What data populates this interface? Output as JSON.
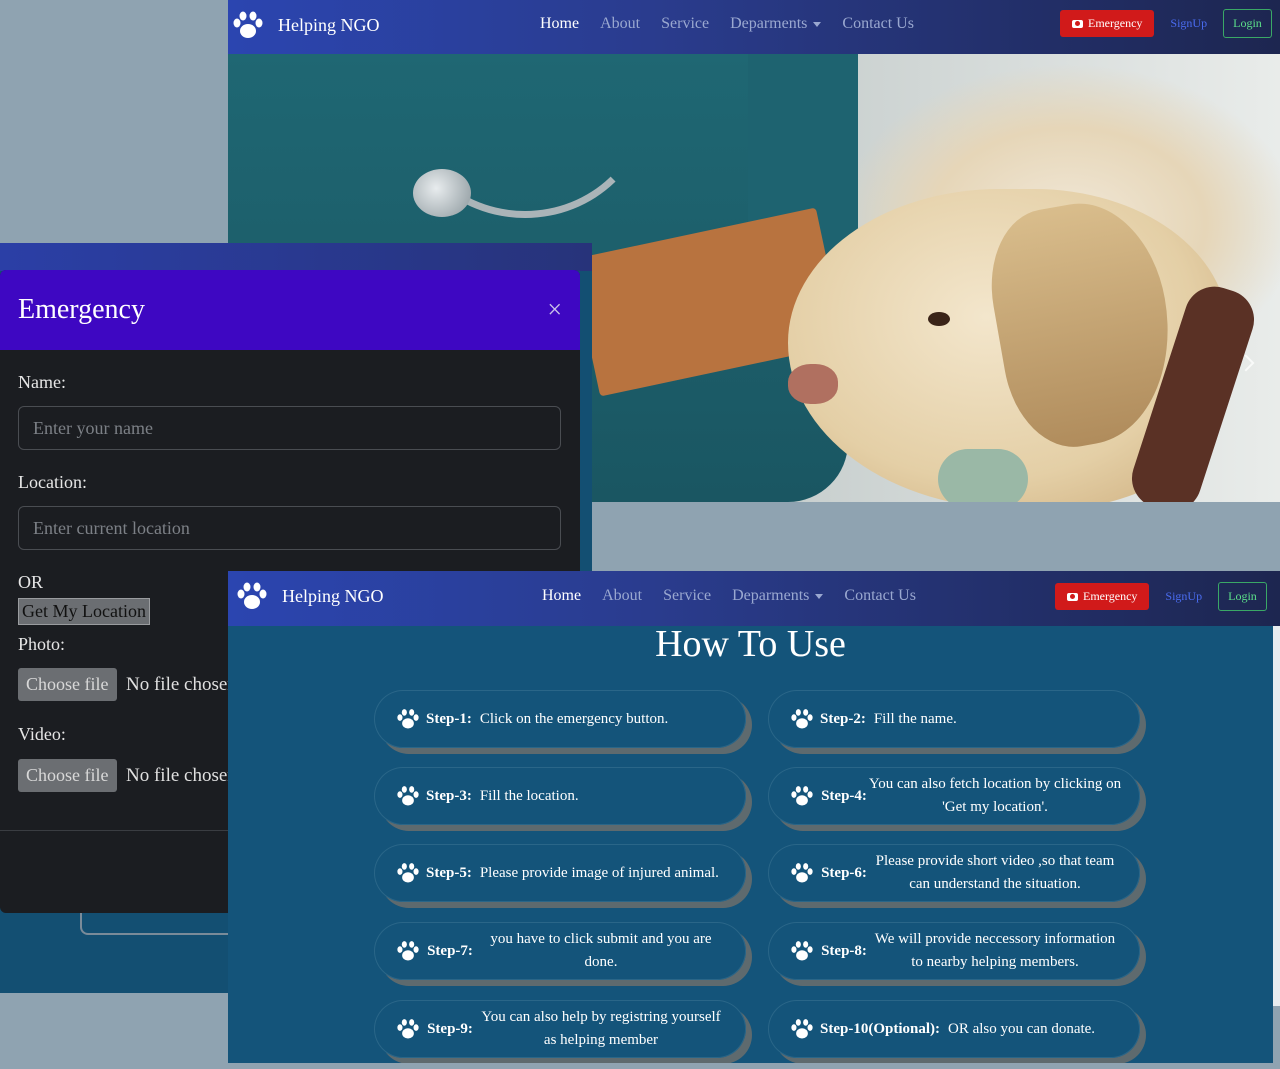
{
  "navbar": {
    "brand": "Helping NGO",
    "links": [
      "Home",
      "About",
      "Service",
      "Deparments",
      "Contact Us"
    ],
    "emergency": "Emergency",
    "signup": "SignUp",
    "login": "Login"
  },
  "modal": {
    "title": "Emergency",
    "close": "×",
    "name_label": "Name:",
    "name_placeholder": "Enter your name",
    "location_label": "Location:",
    "location_placeholder": "Enter current location",
    "or": "OR",
    "get_location": "Get My Location",
    "photo_label": "Photo:",
    "video_label": "Video:",
    "choose_file": "Choose file",
    "no_file": "No file chosen"
  },
  "howto": {
    "title": "How To Use",
    "steps": [
      {
        "label": "Step-1:",
        "text": "Click on the emergency button."
      },
      {
        "label": "Step-2:",
        "text": "Fill the name."
      },
      {
        "label": "Step-3:",
        "text": "Fill the location."
      },
      {
        "label": "Step-4:",
        "text": "You can also fetch location by clicking on 'Get my location'."
      },
      {
        "label": "Step-5:",
        "text": "Please provide image of injured animal."
      },
      {
        "label": "Step-6:",
        "text": "Please provide short video ,so that team can understand the situation."
      },
      {
        "label": "Step-7:",
        "text": "you have to click submit and you are done."
      },
      {
        "label": "Step-8:",
        "text": "We will provide neccessory information to nearby helping members."
      },
      {
        "label": "Step-9:",
        "text": "You can also help by registring yourself as helping member"
      },
      {
        "label": "Step-10(Optional):",
        "text": "OR also you can donate."
      }
    ]
  }
}
